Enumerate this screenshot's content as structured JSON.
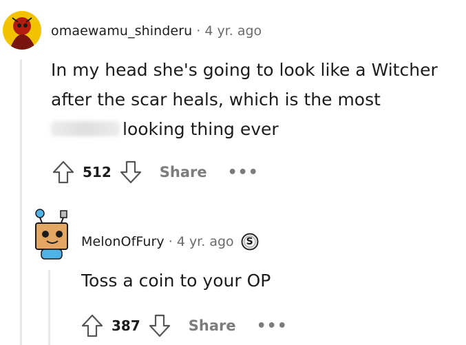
{
  "comments": [
    {
      "username": "omaewamu_shinderu",
      "separator": "·",
      "time": "4 yr. ago",
      "body_line1": "In my head she's going to look like a Witcher",
      "body_line2": "after the scar heals, which is the most",
      "body_line3": "looking thing ever",
      "votes": "512",
      "share_label": "Share",
      "more_label": "•••"
    },
    {
      "username": "MelonOfFury",
      "separator": "·",
      "time": "4 yr. ago",
      "badge": "S",
      "body_line1": "Toss a coin to your OP",
      "votes": "387",
      "share_label": "Share",
      "more_label": "•••"
    }
  ],
  "icons": {
    "upvote": "upvote-arrow-icon",
    "downvote": "downvote-arrow-icon",
    "badge": "silver-coin-award-icon"
  }
}
